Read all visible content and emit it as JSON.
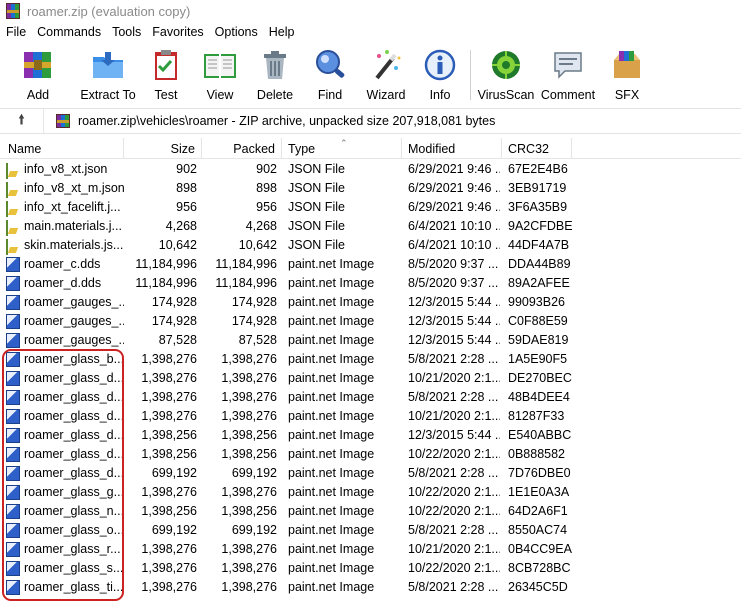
{
  "window": {
    "title": "roamer.zip (evaluation copy)"
  },
  "menu": [
    "File",
    "Commands",
    "Tools",
    "Favorites",
    "Options",
    "Help"
  ],
  "toolbar": [
    {
      "label": "Add",
      "icon": "books-add-icon"
    },
    {
      "label": "Extract To",
      "icon": "folder-extract-icon"
    },
    {
      "label": "Test",
      "icon": "clipboard-test-icon"
    },
    {
      "label": "View",
      "icon": "book-view-icon"
    },
    {
      "label": "Delete",
      "icon": "trash-icon"
    },
    {
      "label": "Find",
      "icon": "magnifier-icon"
    },
    {
      "label": "Wizard",
      "icon": "magic-wand-icon"
    },
    {
      "label": "Info",
      "icon": "info-icon"
    },
    {
      "label": "VirusScan",
      "icon": "virus-scan-icon"
    },
    {
      "label": "Comment",
      "icon": "comment-icon"
    },
    {
      "label": "SFX",
      "icon": "sfx-box-icon"
    }
  ],
  "path": {
    "text": "roamer.zip\\vehicles\\roamer - ZIP archive, unpacked size 207,918,081 bytes"
  },
  "columns": {
    "name": "Name",
    "size": "Size",
    "packed": "Packed",
    "type": "Type",
    "modified": "Modified",
    "crc": "CRC32"
  },
  "files": [
    {
      "name": "info_v8_xt.json",
      "size": "902",
      "packed": "902",
      "type": "JSON File",
      "modified": "6/29/2021 9:46 ...",
      "crc": "67E2E4B6",
      "kind": "json"
    },
    {
      "name": "info_v8_xt_m.json",
      "size": "898",
      "packed": "898",
      "type": "JSON File",
      "modified": "6/29/2021 9:46 ...",
      "crc": "3EB91719",
      "kind": "json"
    },
    {
      "name": "info_xt_facelift.j...",
      "size": "956",
      "packed": "956",
      "type": "JSON File",
      "modified": "6/29/2021 9:46 ...",
      "crc": "3F6A35B9",
      "kind": "json"
    },
    {
      "name": "main.materials.j...",
      "size": "4,268",
      "packed": "4,268",
      "type": "JSON File",
      "modified": "6/4/2021 10:10 ...",
      "crc": "9A2CFDBE",
      "kind": "json"
    },
    {
      "name": "skin.materials.js...",
      "size": "10,642",
      "packed": "10,642",
      "type": "JSON File",
      "modified": "6/4/2021 10:10 ...",
      "crc": "44DF4A7B",
      "kind": "json"
    },
    {
      "name": "roamer_c.dds",
      "size": "11,184,996",
      "packed": "11,184,996",
      "type": "paint.net Image",
      "modified": "8/5/2020 9:37 ...",
      "crc": "DDA44B89",
      "kind": "img"
    },
    {
      "name": "roamer_d.dds",
      "size": "11,184,996",
      "packed": "11,184,996",
      "type": "paint.net Image",
      "modified": "8/5/2020 9:37 ...",
      "crc": "89A2AFEE",
      "kind": "img"
    },
    {
      "name": "roamer_gauges_...",
      "size": "174,928",
      "packed": "174,928",
      "type": "paint.net Image",
      "modified": "12/3/2015 5:44 ...",
      "crc": "99093B26",
      "kind": "img"
    },
    {
      "name": "roamer_gauges_...",
      "size": "174,928",
      "packed": "174,928",
      "type": "paint.net Image",
      "modified": "12/3/2015 5:44 ...",
      "crc": "C0F88E59",
      "kind": "img"
    },
    {
      "name": "roamer_gauges_...",
      "size": "87,528",
      "packed": "87,528",
      "type": "paint.net Image",
      "modified": "12/3/2015 5:44 ...",
      "crc": "59DAE819",
      "kind": "img"
    },
    {
      "name": "roamer_glass_b....",
      "size": "1,398,276",
      "packed": "1,398,276",
      "type": "paint.net Image",
      "modified": "5/8/2021 2:28 ...",
      "crc": "1A5E90F5",
      "kind": "img"
    },
    {
      "name": "roamer_glass_d...",
      "size": "1,398,276",
      "packed": "1,398,276",
      "type": "paint.net Image",
      "modified": "10/21/2020 2:1...",
      "crc": "DE270BEC",
      "kind": "img"
    },
    {
      "name": "roamer_glass_d...",
      "size": "1,398,276",
      "packed": "1,398,276",
      "type": "paint.net Image",
      "modified": "5/8/2021 2:28 ...",
      "crc": "48B4DEE4",
      "kind": "img"
    },
    {
      "name": "roamer_glass_d...",
      "size": "1,398,276",
      "packed": "1,398,276",
      "type": "paint.net Image",
      "modified": "10/21/2020 2:1...",
      "crc": "81287F33",
      "kind": "img"
    },
    {
      "name": "roamer_glass_d...",
      "size": "1,398,256",
      "packed": "1,398,256",
      "type": "paint.net Image",
      "modified": "12/3/2015 5:44 ...",
      "crc": "E540ABBC",
      "kind": "img"
    },
    {
      "name": "roamer_glass_d...",
      "size": "1,398,256",
      "packed": "1,398,256",
      "type": "paint.net Image",
      "modified": "10/22/2020 2:1...",
      "crc": "0B888582",
      "kind": "img"
    },
    {
      "name": "roamer_glass_d...",
      "size": "699,192",
      "packed": "699,192",
      "type": "paint.net Image",
      "modified": "5/8/2021 2:28 ...",
      "crc": "7D76DBE0",
      "kind": "img"
    },
    {
      "name": "roamer_glass_g...",
      "size": "1,398,276",
      "packed": "1,398,276",
      "type": "paint.net Image",
      "modified": "10/22/2020 2:1...",
      "crc": "1E1E0A3A",
      "kind": "img"
    },
    {
      "name": "roamer_glass_n...",
      "size": "1,398,256",
      "packed": "1,398,256",
      "type": "paint.net Image",
      "modified": "10/22/2020 2:1...",
      "crc": "64D2A6F1",
      "kind": "img"
    },
    {
      "name": "roamer_glass_o...",
      "size": "699,192",
      "packed": "699,192",
      "type": "paint.net Image",
      "modified": "5/8/2021 2:28 ...",
      "crc": "8550AC74",
      "kind": "img"
    },
    {
      "name": "roamer_glass_r...",
      "size": "1,398,276",
      "packed": "1,398,276",
      "type": "paint.net Image",
      "modified": "10/21/2020 2:1...",
      "crc": "0B4CC9EA",
      "kind": "img"
    },
    {
      "name": "roamer_glass_s...",
      "size": "1,398,276",
      "packed": "1,398,276",
      "type": "paint.net Image",
      "modified": "10/22/2020 2:1...",
      "crc": "8CB728BC",
      "kind": "img"
    },
    {
      "name": "roamer_glass_ti...",
      "size": "1,398,276",
      "packed": "1,398,276",
      "type": "paint.net Image",
      "modified": "5/8/2021 2:28 ...",
      "crc": "26345C5D",
      "kind": "img"
    }
  ],
  "colors": {
    "highlight": "#cc2222"
  }
}
